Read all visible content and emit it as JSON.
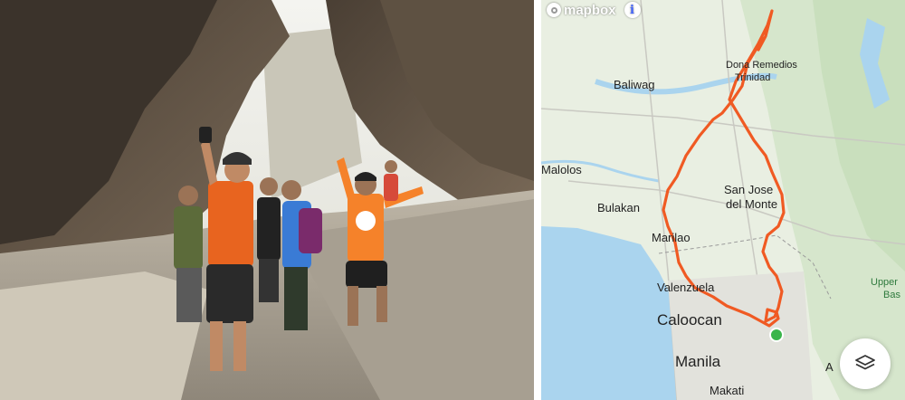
{
  "map": {
    "attribution_logo": "mapbox",
    "info_icon": "info-icon",
    "layers_icon": "layers-icon",
    "route_color": "#f05a23",
    "water_color": "#aad4ee",
    "land_color": "#e9efe2",
    "labels": {
      "dona_remedios": "Dona Remedios",
      "trinidad": "Trinidad",
      "baliwag": "Baliwag",
      "malolos": "Malolos",
      "bulakan": "Bulakan",
      "san_jose": "San Jose",
      "del_monte": "del Monte",
      "marilao": "Marilao",
      "valenzuela": "Valenzuela",
      "caloocan": "Caloocan",
      "manila": "Manila",
      "makati": "Makati",
      "upper": "Upper",
      "bas": "Bas",
      "a": "A"
    }
  },
  "photo": {
    "description_icon": "cyclists-in-cave-photo"
  }
}
